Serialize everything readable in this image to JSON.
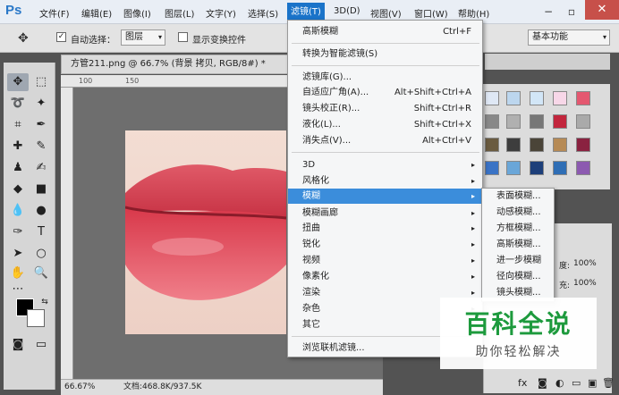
{
  "menubar": {
    "logo": "Ps",
    "items": [
      "文件(F)",
      "编辑(E)",
      "图像(I)",
      "图层(L)",
      "文字(Y)",
      "选择(S)",
      "滤镜(T)",
      "3D(D)",
      "视图(V)",
      "窗口(W)",
      "帮助(H)"
    ],
    "active_index": 6
  },
  "options": {
    "auto_select_label": "自动选择：",
    "auto_select_value": "图层",
    "show_transform_label": "显示变换控件",
    "workspace": "基本功能"
  },
  "document": {
    "tab_title": "方管211.png @ 66.7% (背景 拷贝, RGB/8#) *",
    "zoom": "66.67%",
    "doc_info": "文档:468.8K/937.5K",
    "ruler_ticks": [
      "100",
      "150"
    ]
  },
  "filter_menu": {
    "items": [
      {
        "label": "高斯模糊",
        "shortcut": "Ctrl+F"
      },
      {
        "label": "转换为智能滤镜(S)",
        "shortcut": ""
      },
      {
        "label": "滤镜库(G)...",
        "shortcut": ""
      },
      {
        "label": "自适应广角(A)...",
        "shortcut": "Alt+Shift+Ctrl+A"
      },
      {
        "label": "镜头校正(R)...",
        "shortcut": "Shift+Ctrl+R"
      },
      {
        "label": "液化(L)...",
        "shortcut": "Shift+Ctrl+X"
      },
      {
        "label": "消失点(V)...",
        "shortcut": "Alt+Ctrl+V"
      },
      {
        "label": "3D",
        "shortcut": ""
      },
      {
        "label": "风格化",
        "shortcut": ""
      },
      {
        "label": "模糊",
        "shortcut": ""
      },
      {
        "label": "模糊画廊",
        "shortcut": ""
      },
      {
        "label": "扭曲",
        "shortcut": ""
      },
      {
        "label": "锐化",
        "shortcut": ""
      },
      {
        "label": "视频",
        "shortcut": ""
      },
      {
        "label": "像素化",
        "shortcut": ""
      },
      {
        "label": "渲染",
        "shortcut": ""
      },
      {
        "label": "杂色",
        "shortcut": ""
      },
      {
        "label": "其它",
        "shortcut": ""
      },
      {
        "label": "浏览联机滤镜...",
        "shortcut": ""
      }
    ],
    "highlighted": "模糊"
  },
  "blur_submenu": {
    "items": [
      "表面模糊...",
      "动感模糊...",
      "方框模糊...",
      "高斯模糊...",
      "进一步模糊",
      "径向模糊...",
      "镜头模糊..."
    ]
  },
  "layers": {
    "opacity_label": "度:",
    "opacity_value": "100%",
    "fill_label": "充:",
    "fill_value": "100%"
  },
  "watermark": {
    "title": "百科全说",
    "subtitle": "助你轻松解决"
  },
  "colors": {
    "menu_highlight": "#3b8ddb",
    "active_menu": "#1a73c9",
    "watermark_green": "#1d9a3d"
  }
}
